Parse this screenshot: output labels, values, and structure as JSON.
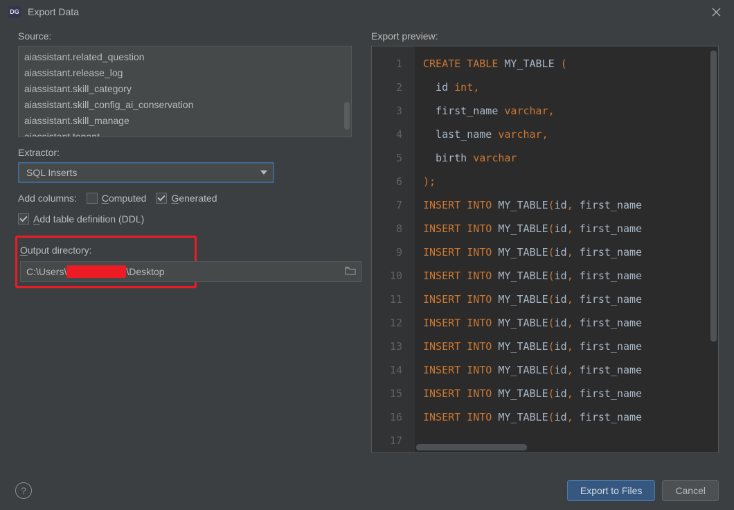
{
  "window": {
    "app_badge": "DG",
    "title": "Export Data"
  },
  "left": {
    "source_label": "Source:",
    "source_items": [
      "aiassistant.related_question",
      "aiassistant.release_log",
      "aiassistant.skill_category",
      "aiassistant.skill_config_ai_conservation",
      "aiassistant.skill_manage",
      "aiassistant.tenant"
    ],
    "extractor_label": "Extractor:",
    "extractor_value": "SQL Inserts",
    "add_columns_label": "Add columns:",
    "computed_label": "Computed",
    "generated_label": "Generated",
    "computed_checked": false,
    "generated_checked": true,
    "ddl_label": "Add table definition (DDL)",
    "ddl_checked": true,
    "output_dir_label": "Output directory:",
    "output_dir_prefix": "C:\\Users\\",
    "output_dir_suffix": "\\Desktop"
  },
  "right": {
    "preview_label": "Export preview:",
    "code_lines": [
      {
        "t": "ddl_create",
        "text": "CREATE TABLE MY_TABLE ("
      },
      {
        "t": "ddl_col",
        "text": "  id int,"
      },
      {
        "t": "ddl_col",
        "text": "  first_name varchar,"
      },
      {
        "t": "ddl_col",
        "text": "  last_name varchar,"
      },
      {
        "t": "ddl_col",
        "text": "  birth varchar"
      },
      {
        "t": "ddl_end",
        "text": ");"
      },
      {
        "t": "insert",
        "text": "INSERT INTO MY_TABLE(id, first_name"
      },
      {
        "t": "insert",
        "text": "INSERT INTO MY_TABLE(id, first_name"
      },
      {
        "t": "insert",
        "text": "INSERT INTO MY_TABLE(id, first_name"
      },
      {
        "t": "insert",
        "text": "INSERT INTO MY_TABLE(id, first_name"
      },
      {
        "t": "insert",
        "text": "INSERT INTO MY_TABLE(id, first_name"
      },
      {
        "t": "insert",
        "text": "INSERT INTO MY_TABLE(id, first_name"
      },
      {
        "t": "insert",
        "text": "INSERT INTO MY_TABLE(id, first_name"
      },
      {
        "t": "insert",
        "text": "INSERT INTO MY_TABLE(id, first_name"
      },
      {
        "t": "insert",
        "text": "INSERT INTO MY_TABLE(id, first_name"
      },
      {
        "t": "insert",
        "text": "INSERT INTO MY_TABLE(id, first_name"
      },
      {
        "t": "blank",
        "text": ""
      }
    ]
  },
  "footer": {
    "export_label": "Export to Files",
    "cancel_label": "Cancel"
  }
}
